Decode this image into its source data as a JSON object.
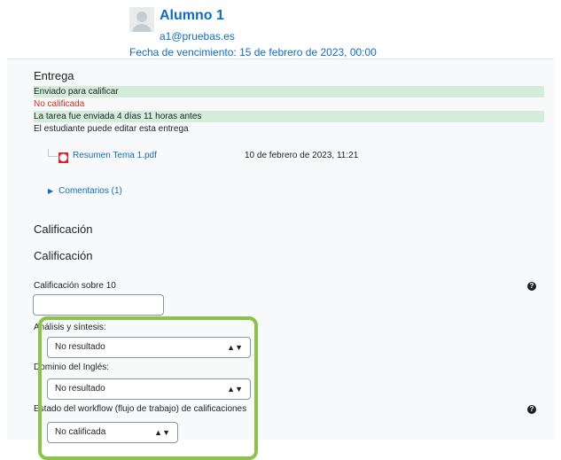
{
  "header": {
    "student_name": "Alumno 1",
    "student_email": "a1@pruebas.es",
    "due_date": "Fecha de vencimiento: 15 de febrero de 2023, 00:00"
  },
  "submission": {
    "heading": "Entrega",
    "status": "Enviado para calificar",
    "grading_status": "No calificada",
    "time_status": "La tarea fue enviada 4 días 11 horas antes",
    "edit_status": "El estudiante puede editar esta entrega",
    "file": {
      "name": "Resumen Tema 1.pdf",
      "date": "10 de febrero de 2023, 11:21",
      "icon": "pdf-icon"
    },
    "comments_label": "Comentarios (1)"
  },
  "grade": {
    "section_heading": "Calificación",
    "sub_heading": "Calificación",
    "out_of_label": "Calificación sobre 10",
    "out_of_value": "",
    "criteria": [
      {
        "label": "Análisis y síntesis:",
        "value": "No resultado"
      },
      {
        "label": "Dominio del Inglés:",
        "value": "No resultado"
      }
    ],
    "workflow_label": "Estado del workflow (flujo de trabajo) de calificaciones",
    "workflow_value": "No calificada"
  },
  "colors": {
    "link": "#0f6cbf",
    "success_bg": "#d4edda",
    "danger": "#ca3120",
    "highlight": "#8bc34a"
  }
}
